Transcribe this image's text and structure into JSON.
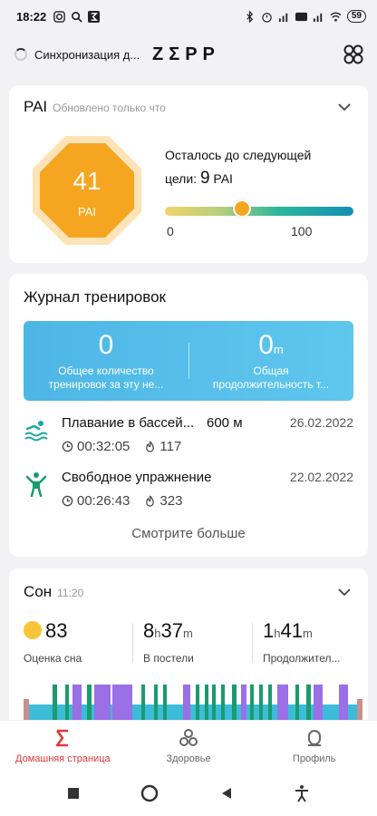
{
  "status_bar": {
    "time": "18:22",
    "battery": "59"
  },
  "header": {
    "sync_text": "Синхронизация д...",
    "logo": "ZΣPP"
  },
  "pai": {
    "title": "PAI",
    "subtitle": "Обновлено только что",
    "value": "41",
    "unit": "PAI",
    "remain_text": "Осталось до следующей",
    "remain_prefix": "цели:",
    "remain_value": "9",
    "remain_unit": "PAI",
    "scale_min": "0",
    "scale_max": "100",
    "progress_fraction": 0.41
  },
  "workouts": {
    "title": "Журнал тренировок",
    "total_count": "0",
    "total_count_caption": "Общее количество тренировок за эту не...",
    "total_duration": "0",
    "total_duration_unit": "m",
    "total_duration_caption": "Общая продолжительность т...",
    "items": [
      {
        "name": "Плавание в бассей...",
        "distance": "600 м",
        "date": "26.02.2022",
        "duration": "00:32:05",
        "calories": "117",
        "icon": "swimming-icon"
      },
      {
        "name": "Свободное упражнение",
        "distance": "",
        "date": "22.02.2022",
        "duration": "00:26:43",
        "calories": "323",
        "icon": "free-exercise-icon"
      }
    ],
    "see_more": "Смотрите больше"
  },
  "sleep": {
    "title": "Сон",
    "time": "11:20",
    "score": "83",
    "score_label": "Оценка сна",
    "bed_hours": "8",
    "bed_minutes": "37",
    "bed_label": "В постели",
    "dur_hours": "1",
    "dur_minutes": "41",
    "dur_label": "Продолжител...",
    "hour_unit": "h",
    "minute_unit": "m"
  },
  "tabbar": [
    {
      "label": "Домашняя страница",
      "icon": "sigma-home-icon",
      "active": true
    },
    {
      "label": "Здоровье",
      "icon": "health-icon",
      "active": false
    },
    {
      "label": "Профиль",
      "icon": "profile-icon",
      "active": false
    }
  ],
  "colors": {
    "accent": "#e13a3a",
    "pai_orange": "#f6a521",
    "workout_banner": "#4eb6e6",
    "sleep_bar": "#3cbcd8",
    "sleep_deep": "#1a9b6d",
    "sleep_rem": "#9b6fe6"
  }
}
